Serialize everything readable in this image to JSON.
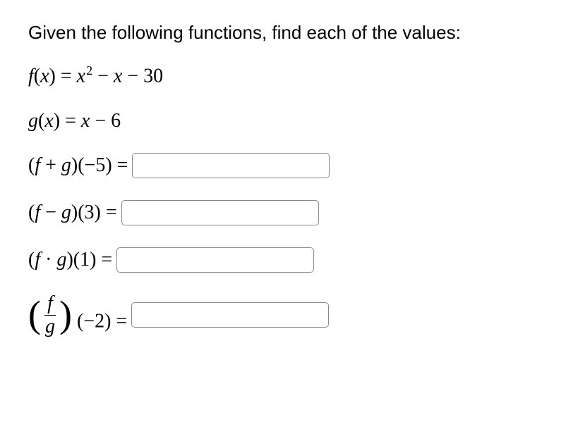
{
  "title": "Given the following functions, find each of the values:",
  "f_def": "f(x) = x² − x − 30",
  "g_def": "g(x) = x − 6",
  "problems": {
    "p1_expr": "(f + g)(−5) =",
    "p2_expr": "(f − g)(3) =",
    "p3_expr": "(f · g)(1) =",
    "p4_frac_num": "f",
    "p4_frac_den": "g",
    "p4_arg": "(−2) ="
  }
}
